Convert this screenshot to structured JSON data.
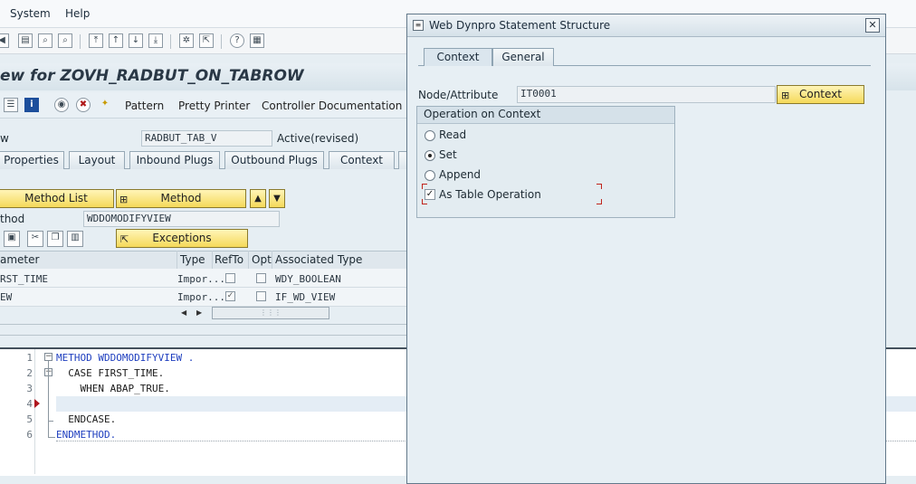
{
  "menu": {
    "system": "System",
    "help": "Help"
  },
  "page_title": "ew for ZOVH_RADBUT_ON_TABROW",
  "app_toolbar": {
    "pattern": "Pattern",
    "pretty_printer": "Pretty Printer",
    "controller_documentation": "Controller Documentation"
  },
  "view_row": {
    "label": "w",
    "value": "RADBUT_TAB_V",
    "status": "Active(revised)"
  },
  "tabs": [
    "Properties",
    "Layout",
    "Inbound Plugs",
    "Outbound Plugs",
    "Context"
  ],
  "buttons": {
    "method_list": "Method List",
    "method": "Method",
    "exceptions": "Exceptions"
  },
  "method_row": {
    "label": "thod",
    "value": "WDDOMODIFYVIEW"
  },
  "table": {
    "headers": [
      "ameter",
      "Type",
      "RefTo",
      "Opt",
      "Associated Type"
    ],
    "rows": [
      {
        "param": "RST_TIME",
        "type": "Impor...",
        "refto": false,
        "opt": false,
        "assoc": "WDY_BOOLEAN"
      },
      {
        "param": "EW",
        "type": "Impor...",
        "refto": true,
        "opt": false,
        "assoc": "IF_WD_VIEW"
      }
    ]
  },
  "code": {
    "line_numbers": [
      "1",
      "2",
      "3",
      "4",
      "5",
      "6"
    ],
    "lines": [
      "METHOD WDDOMODIFYVIEW .",
      "  CASE FIRST_TIME.",
      "    WHEN ABAP_TRUE.",
      "",
      "  ENDCASE.",
      "ENDMETHOD."
    ]
  },
  "dialog": {
    "title": "Web Dynpro Statement Structure",
    "close": "✕",
    "tabs": [
      "Context",
      "General"
    ],
    "node_label": "Node/Attribute",
    "node_value": "IT0001",
    "context_button": "Context",
    "group_title": "Operation on Context",
    "options": [
      "Read",
      "Set",
      "Append"
    ],
    "selected_option": "Set",
    "checkbox_label": "As Table Operation",
    "checkbox_checked": true
  },
  "colors": {
    "yellow_button": "#f5d95a",
    "dialog_bg": "#e7eff4",
    "keyword_blue": "#1f3fbf"
  }
}
